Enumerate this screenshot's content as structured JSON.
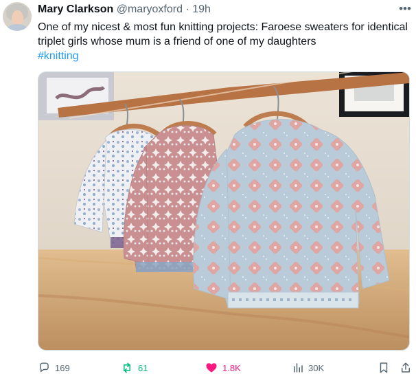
{
  "tweet": {
    "author_name": "Mary Clarkson",
    "handle": "@maryoxford",
    "separator": "·",
    "time": "19h",
    "text": "One of my nicest & most fun knitting projects: Faroese sweaters for identical triplet girls whose mum is a friend of one of my daughters",
    "hashtag": "#knitting"
  },
  "stats": {
    "replies": "169",
    "retweets": "61",
    "likes": "1.8K",
    "views": "30K"
  },
  "icons": {
    "more": "more-icon",
    "reply": "reply-icon",
    "retweet": "retweet-icon",
    "like": "heart-icon",
    "views": "analytics-icon",
    "bookmark": "bookmark-icon",
    "share": "share-icon"
  },
  "colors": {
    "text": "#0f1419",
    "muted": "#536471",
    "link": "#1d9bf0",
    "retweet": "#00ba7c",
    "like": "#f91880"
  }
}
